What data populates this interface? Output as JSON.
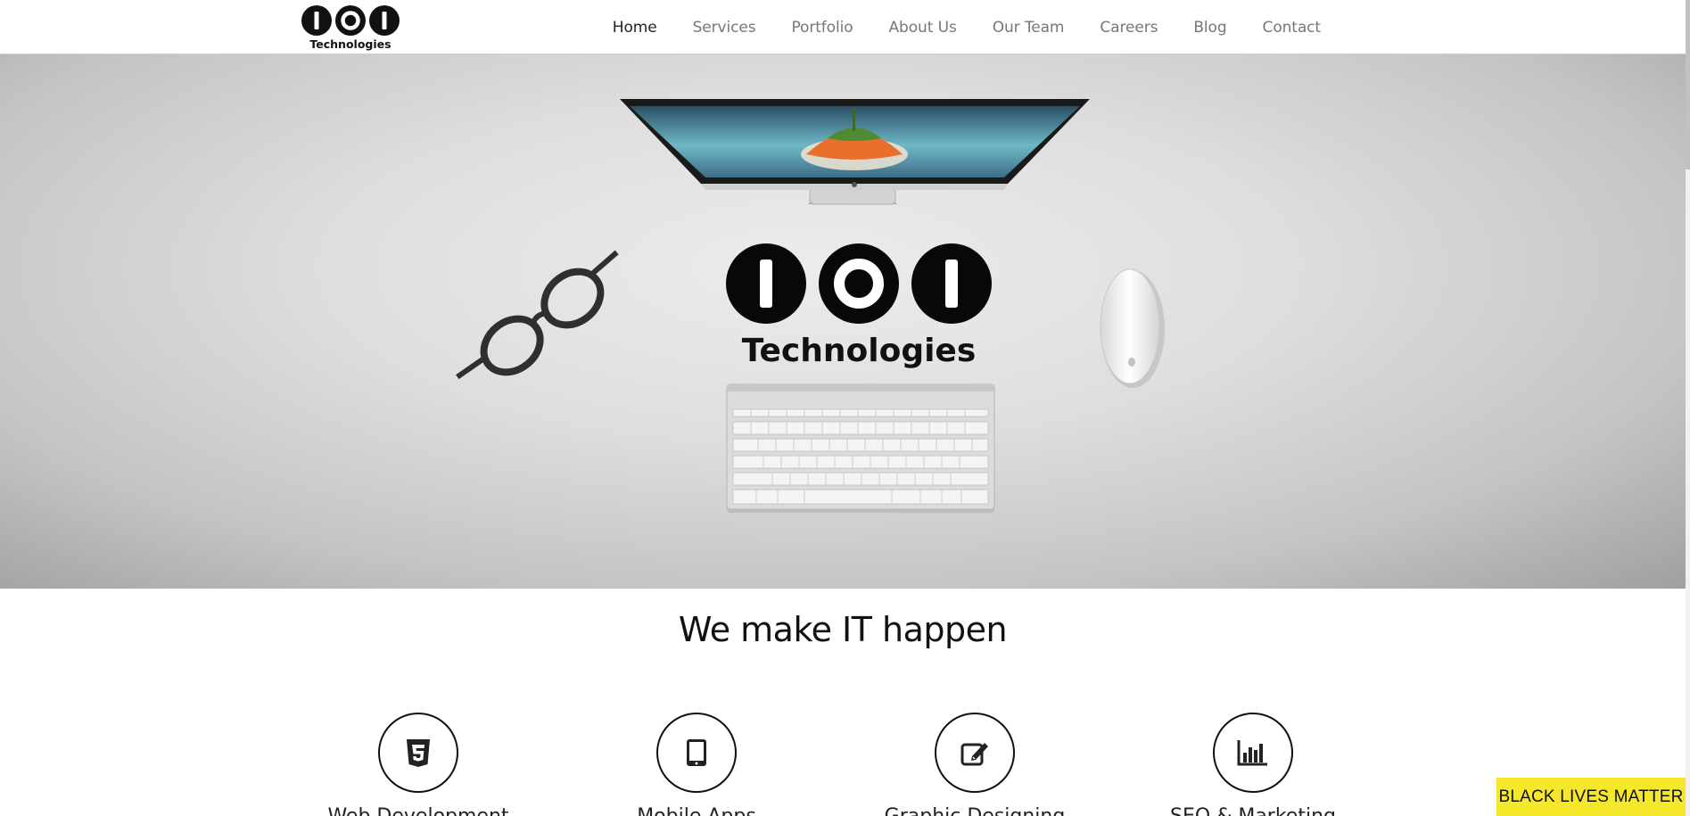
{
  "brand": {
    "logo_text": "Technologies"
  },
  "nav": {
    "items": [
      {
        "label": "Home",
        "active": true
      },
      {
        "label": "Services",
        "active": false
      },
      {
        "label": "Portfolio",
        "active": false
      },
      {
        "label": "About Us",
        "active": false
      },
      {
        "label": "Our Team",
        "active": false
      },
      {
        "label": "Careers",
        "active": false
      },
      {
        "label": "Blog",
        "active": false
      },
      {
        "label": "Contact",
        "active": false
      }
    ]
  },
  "hero": {
    "logo_text": "Technologies"
  },
  "main": {
    "headline": "We make IT happen",
    "services": [
      {
        "icon": "html5-icon",
        "label": "Web Development"
      },
      {
        "icon": "tablet-icon",
        "label": "Mobile Apps"
      },
      {
        "icon": "edit-icon",
        "label": "Graphic Designing"
      },
      {
        "icon": "bar-chart-icon",
        "label": "SEO & Marketing"
      }
    ]
  },
  "banner": {
    "label": "BLACK LIVES MATTER"
  },
  "colors": {
    "accent_yellow": "#f5e82a",
    "text": "#111111",
    "nav_text": "#777777"
  }
}
